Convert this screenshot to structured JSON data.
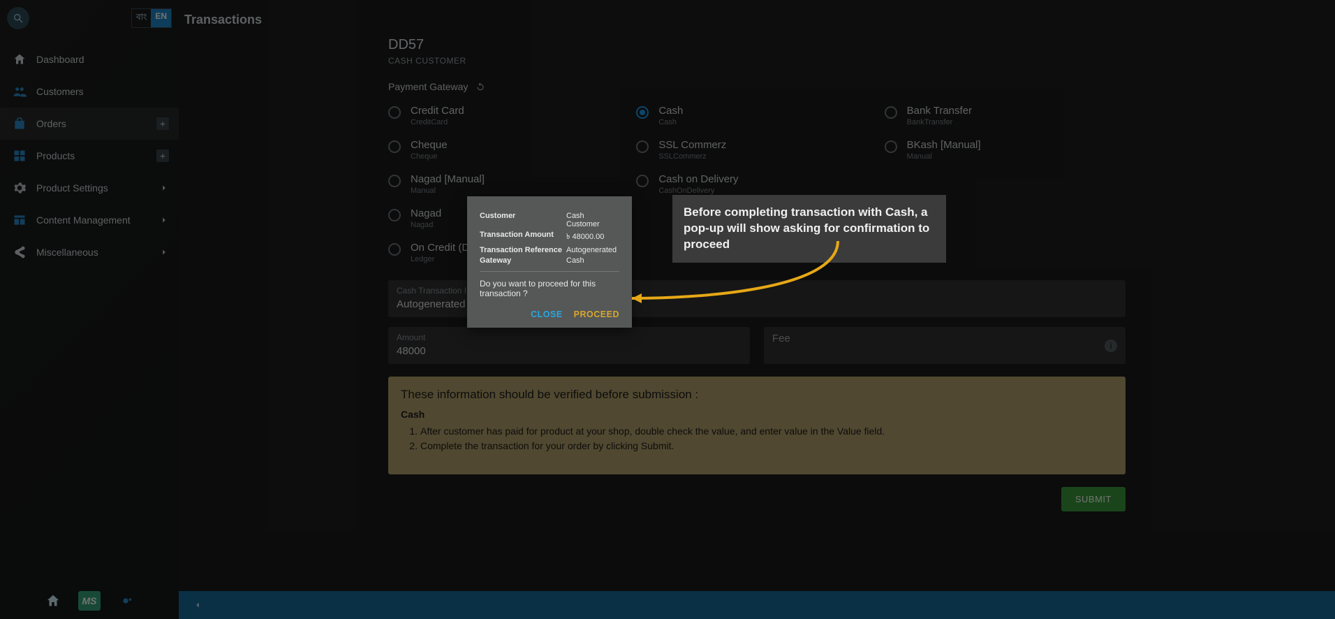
{
  "lang": {
    "inactive": "বাং",
    "active": "EN"
  },
  "sidebar": {
    "items": [
      {
        "label": "Dashboard"
      },
      {
        "label": "Customers"
      },
      {
        "label": "Orders"
      },
      {
        "label": "Products"
      },
      {
        "label": "Product Settings"
      },
      {
        "label": "Content Management"
      },
      {
        "label": "Miscellaneous"
      }
    ]
  },
  "page": {
    "title": "Transactions"
  },
  "order": {
    "id": "DD57",
    "customer_type": "CASH CUSTOMER"
  },
  "pg_label": "Payment Gateway",
  "gateways": [
    {
      "label": "Credit Card",
      "sub": "CreditCard"
    },
    {
      "label": "Cash",
      "sub": "Cash"
    },
    {
      "label": "Bank Transfer",
      "sub": "BankTransfer"
    },
    {
      "label": "Cheque",
      "sub": "Cheque"
    },
    {
      "label": "SSL Commerz",
      "sub": "SSLCommerz"
    },
    {
      "label": "BKash [Manual]",
      "sub": "Manual"
    },
    {
      "label": "Nagad [Manual]",
      "sub": "Manual"
    },
    {
      "label": "Cash on Delivery",
      "sub": "CashOnDelivery"
    },
    {
      "label": "",
      "sub": ""
    },
    {
      "label": "Nagad",
      "sub": "Nagad"
    },
    {
      "label": "",
      "sub": ""
    },
    {
      "label": "",
      "sub": ""
    },
    {
      "label": "On Credit (Due)",
      "sub": "Ledger"
    }
  ],
  "fields": {
    "txid_label": "Cash Transaction ID",
    "txid_value": "Autogenerated",
    "amount_label": "Amount",
    "amount_value": "48000",
    "fee_label": "Fee"
  },
  "instructions": {
    "heading": "These information should be verified before submission :",
    "sub": "Cash",
    "steps": [
      "After customer has paid for product at your shop, double check the value, and enter value in the Value field.",
      "Complete the transaction for your order by clicking Submit."
    ]
  },
  "submit_label": "SUBMIT",
  "dialog": {
    "rows": {
      "customer_k": "Customer",
      "customer_v": "Cash Customer",
      "amount_k": "Transaction Amount",
      "amount_v": "৳ 48000.00",
      "ref_k": "Transaction Reference",
      "ref_v": "Autogenerated",
      "gateway_k": "Gateway",
      "gateway_v": "Cash"
    },
    "question": "Do you want to proceed for this transaction ?",
    "close": "CLOSE",
    "proceed": "PROCEED"
  },
  "callout": "Before completing transaction with Cash, a pop-up will show asking for confirmation to proceed"
}
